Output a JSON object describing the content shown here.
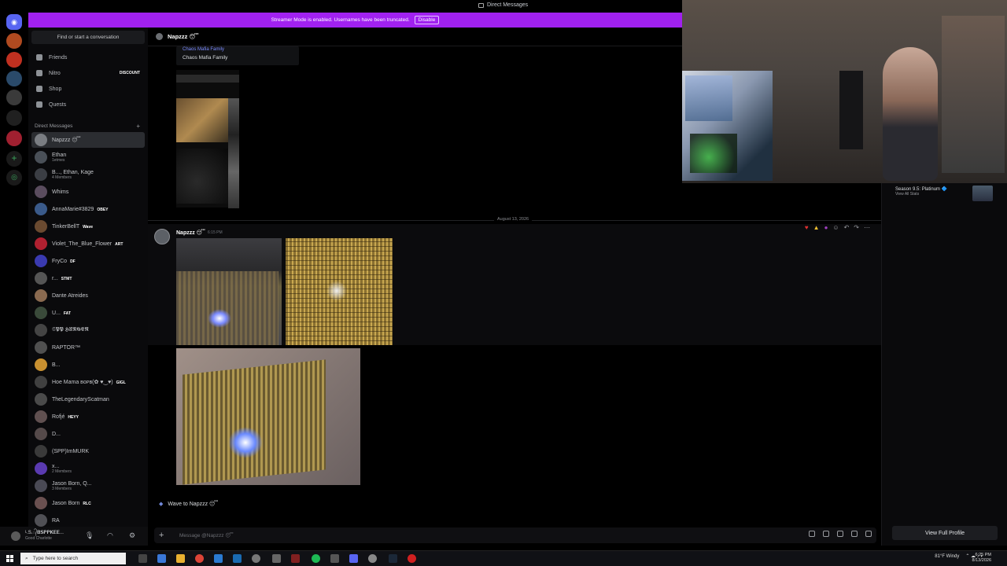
{
  "window": {
    "title": "Direct Messages"
  },
  "banner": {
    "text": "Streamer Mode is enabled. Usernames have been truncated.",
    "button": "Disable",
    "color": "#a121f0"
  },
  "sidebar": {
    "search_placeholder": "Find or start a conversation",
    "nav": [
      {
        "label": "Friends",
        "icon": "friends-icon"
      },
      {
        "label": "Nitro",
        "icon": "nitro-icon",
        "badge": "DISCOUNT"
      },
      {
        "label": "Shop",
        "icon": "shop-icon"
      },
      {
        "label": "Quests",
        "icon": "quests-icon"
      }
    ],
    "dm_header": "Direct Messages",
    "dms": [
      {
        "name": "Napzzz 😴",
        "sub": "",
        "tag": "",
        "color": "#7a7d82"
      },
      {
        "name": "Ethan",
        "sub": "1etmes",
        "tag": "",
        "color": "#4a5058"
      },
      {
        "name": "B..., Ethan, Kage",
        "sub": "4 Members",
        "tag": "",
        "color": "#3b3e44"
      },
      {
        "name": "Whims",
        "sub": "",
        "tag": "",
        "color": "#5a4c5e"
      },
      {
        "name": "AnnaMarie#3829",
        "sub": "",
        "tag": "OBEY",
        "color": "#3a5a8a"
      },
      {
        "name": "TinkerBellT",
        "sub": "",
        "tag": "Wave",
        "color": "#6a4a30"
      },
      {
        "name": "Violet_The_Blue_Flower",
        "sub": "",
        "tag": "ART",
        "color": "#b02030"
      },
      {
        "name": "FryCo",
        "sub": "",
        "tag": "DF",
        "color": "#3a3ab0"
      },
      {
        "name": "r...",
        "sub": "",
        "tag": "STMT",
        "color": "#555"
      },
      {
        "name": "Dante Atreides",
        "sub": "",
        "tag": "",
        "color": "#8a6a50"
      },
      {
        "name": "U...",
        "sub": "",
        "tag": "FAT",
        "color": "#3a4a3a"
      },
      {
        "name": "𝕾𝕻𝕻 𝕳𝖀𝕹𝕲𝕰𝕽",
        "sub": "",
        "tag": "",
        "color": "#444"
      },
      {
        "name": "RAPTOR™",
        "sub": "",
        "tag": "",
        "color": "#505050"
      },
      {
        "name": "B...",
        "sub": "",
        "tag": "",
        "color": "#c89030"
      },
      {
        "name": "Hoe Mama ʙᴏᴘʙ(✿ ♥‿♥)",
        "sub": "",
        "tag": "GIGL",
        "color": "#404040"
      },
      {
        "name": "TheLegendaryScatman",
        "sub": "",
        "tag": "",
        "color": "#4a4a4a"
      },
      {
        "name": "Rofjé",
        "sub": "",
        "tag": "HEYY",
        "color": "#605050"
      },
      {
        "name": "D...",
        "sub": "",
        "tag": "",
        "color": "#554a4a"
      },
      {
        "name": "(SPP)ImMURK",
        "sub": "",
        "tag": "",
        "color": "#3a3a3a"
      },
      {
        "name": "x...",
        "sub": "2 Members",
        "tag": "",
        "color": "#5a3ab0"
      },
      {
        "name": "Jason Born, Q...",
        "sub": "3 Members",
        "tag": "",
        "color": "#4a4a55"
      },
      {
        "name": "Jason Born",
        "sub": "",
        "tag": "RLC",
        "color": "#6a5050"
      },
      {
        "name": "RA",
        "sub": "",
        "tag": "",
        "color": "#505055"
      }
    ]
  },
  "user_panel": {
    "name": "ᴸ.S.᭄𝐁𝐒𝐏𝐏𝐊𝐄𝐄...",
    "status": "Good Charlotte"
  },
  "chat": {
    "header_name": "Napzzz 😴",
    "embed_top": "Chaos Mafia Family",
    "embed_label": "Chaos Mafia Family",
    "date_divider": "August 13, 2026",
    "message": {
      "author": "Napzzz 😴",
      "time": "6:15 PM"
    },
    "wave_label": "Wave to Napzzz 😴",
    "input_placeholder": "Message @Napzzz 😴"
  },
  "profile": {
    "season": "Season 9.5: Platinum 🔷",
    "view_stats": "View All Stats",
    "view_full_profile": "View Full Profile"
  },
  "taskbar": {
    "search_placeholder": "Type here to search",
    "weather": "81°F Windy",
    "time": "6:25 PM",
    "date": "8/13/2026"
  }
}
